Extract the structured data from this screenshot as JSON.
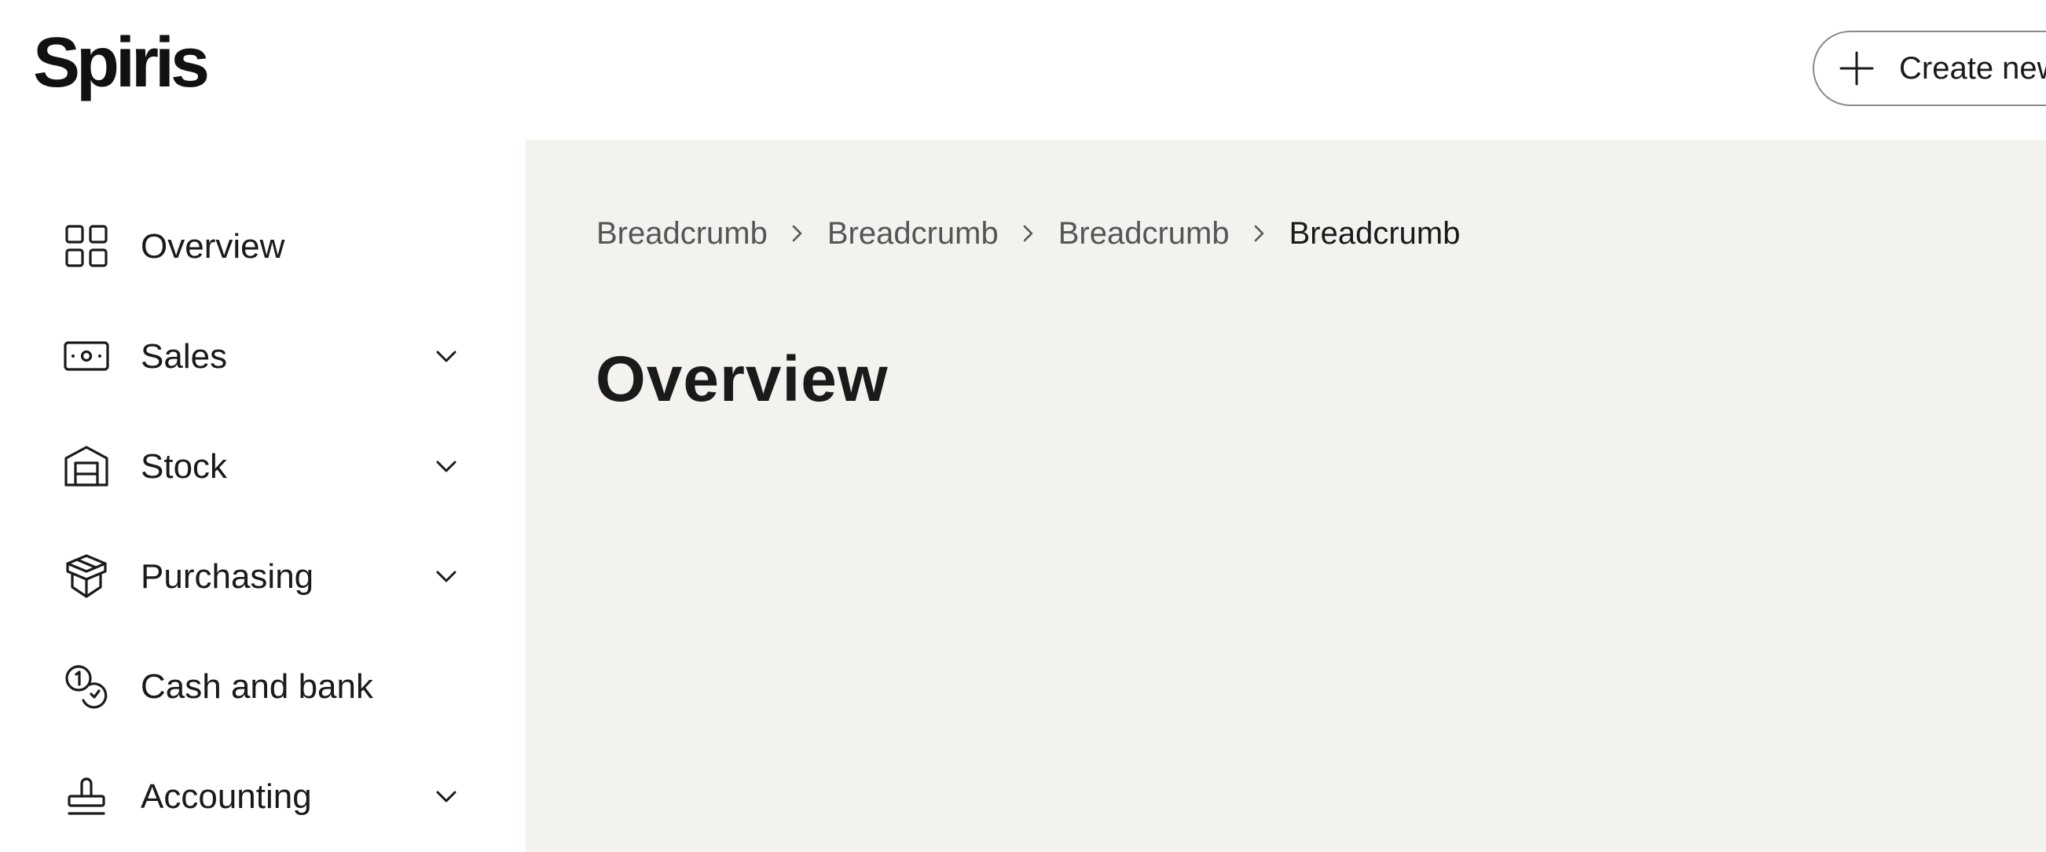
{
  "app": {
    "logo_text": "Spiris"
  },
  "header": {
    "create_button_label": "Create new"
  },
  "sidebar": {
    "items": [
      {
        "label": "Overview",
        "icon": "grid-icon",
        "has_chevron": false
      },
      {
        "label": "Sales",
        "icon": "banknote-icon",
        "has_chevron": true
      },
      {
        "label": "Stock",
        "icon": "warehouse-icon",
        "has_chevron": true
      },
      {
        "label": "Purchasing",
        "icon": "box-icon",
        "has_chevron": true
      },
      {
        "label": "Cash and bank",
        "icon": "coins-icon",
        "has_chevron": false
      },
      {
        "label": "Accounting",
        "icon": "stamp-icon",
        "has_chevron": true
      }
    ]
  },
  "main": {
    "breadcrumbs": [
      "Breadcrumb",
      "Breadcrumb",
      "Breadcrumb",
      "Breadcrumb"
    ],
    "page_title": "Overview"
  },
  "colors": {
    "main_background": "#f3f2ef",
    "sidebar_background": "#ffffff",
    "text_primary": "#1a1a1a",
    "text_secondary": "#555555"
  }
}
